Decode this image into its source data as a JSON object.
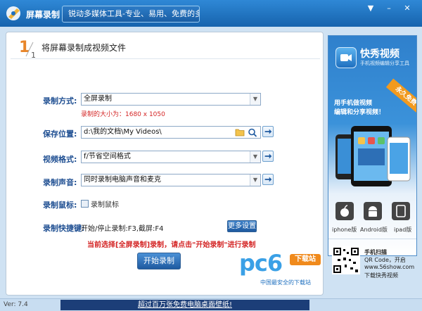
{
  "app": {
    "title": "屏幕录制",
    "slogan": "锐动多媒体工具-专业、易用、免费的多媒体工具"
  },
  "panel": {
    "step_number": "1",
    "step_total": "1",
    "header": "将屏幕录制成视频文件"
  },
  "form": {
    "mode": {
      "label": "录制方式:",
      "value": "全屏录制",
      "size_note": "录制的大小为：1680 x 1050"
    },
    "save": {
      "label": "保存位置:",
      "value": "d:\\我的文档\\My Videos\\"
    },
    "format": {
      "label": "视频格式:",
      "value": "f/节省空间格式"
    },
    "audio": {
      "label": "录制声音:",
      "value": "同时录制电脑声音和麦克"
    },
    "mouse": {
      "label": "录制鼠标:",
      "checkbox_label": "录制鼠标",
      "checked": false
    },
    "hotkey": {
      "label": "录制快捷键:",
      "value": "开始/停止录制:F3,截屏:F4",
      "more_button": "更多设置"
    },
    "hint": "当前选择[全屏录制]录制，请点击\"开始录制\"进行录制",
    "start_button": "开始录制"
  },
  "ad": {
    "title": "快秀视频",
    "subtitle": "手机视频编辑分享工具",
    "ribbon": "永久免费",
    "tagline_1": "用手机做视频",
    "tagline_2": "编辑和分享视频！",
    "platforms": [
      "iphone版",
      "Android版",
      "ipad版"
    ],
    "qr_lines": [
      "手机扫描",
      "QR Code，开启",
      "www.56show.com",
      "下载快秀视频"
    ]
  },
  "watermark": {
    "logo": "pc6",
    "badge": "下载站",
    "tagline": "中国最安全的下载站"
  },
  "status": {
    "version": "Ver: 7.4",
    "banner": "超过百万张免费电脑桌面壁纸!"
  },
  "colors": {
    "title_bar": "#1e6fbf",
    "label_blue": "#1f4f92",
    "warning_red": "#d42525",
    "ribbon_orange": "#f29a1e"
  }
}
